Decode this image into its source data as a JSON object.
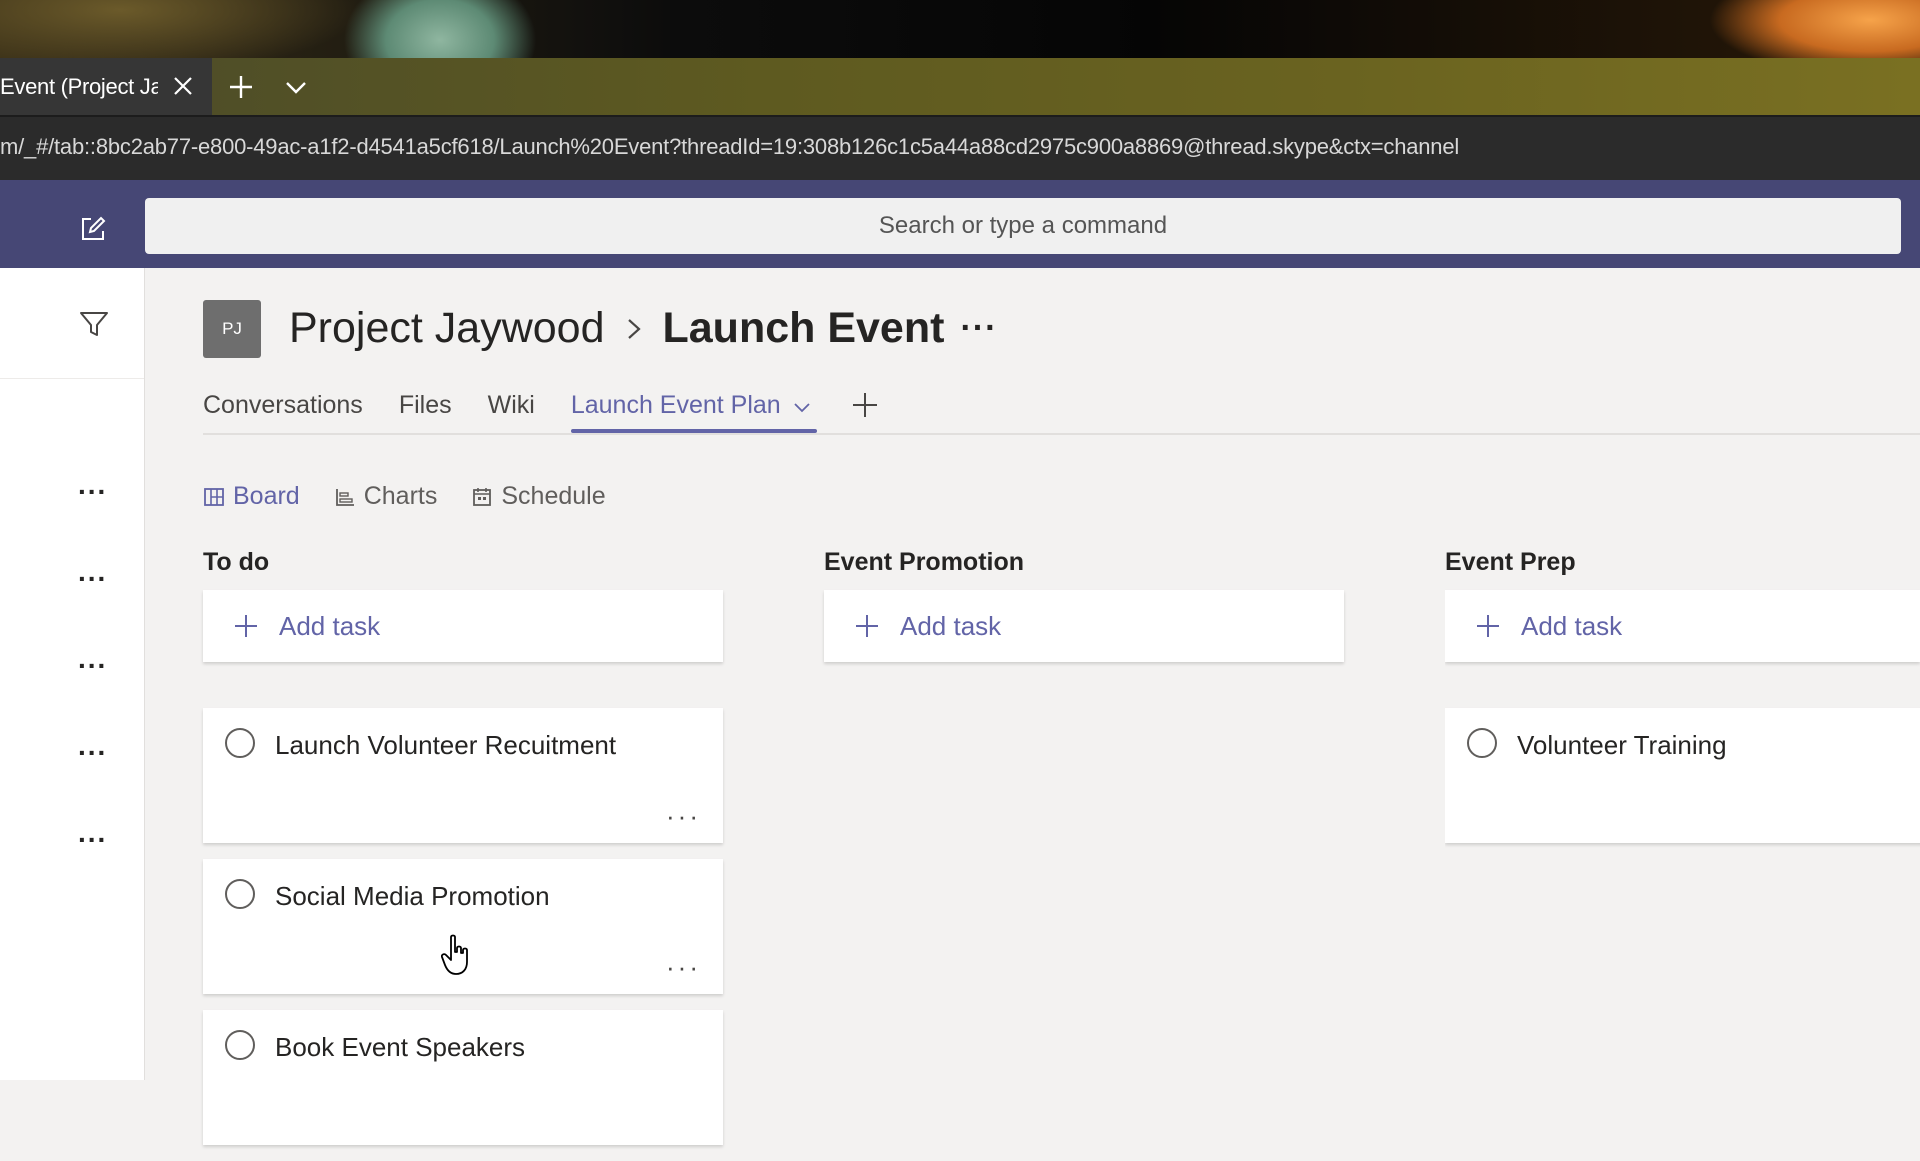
{
  "browser": {
    "tab_title": "Event (Project Ja",
    "url": "m/_#/tab::8bc2ab77-e800-49ac-a1f2-d4541a5cf618/Launch%20Event?threadId=19:308b126c1c5a44a88cd2975c900a8869@thread.skype&ctx=channel"
  },
  "header": {
    "search_placeholder": "Search or type a command"
  },
  "team": {
    "avatar_initials": "PJ",
    "team_name": "Project Jaywood",
    "channel_name": "Launch Event",
    "more": "···"
  },
  "channel_tabs": [
    {
      "label": "Conversations"
    },
    {
      "label": "Files"
    },
    {
      "label": "Wiki"
    },
    {
      "label": "Launch Event Plan",
      "active": true
    }
  ],
  "views": [
    {
      "label": "Board",
      "icon": "board-icon",
      "active": true
    },
    {
      "label": "Charts",
      "icon": "charts-icon"
    },
    {
      "label": "Schedule",
      "icon": "schedule-icon"
    }
  ],
  "rail": {
    "more_label": "..."
  },
  "buckets": [
    {
      "title": "To do",
      "add_label": "Add task",
      "tasks": [
        {
          "title": "Launch Volunteer Recuitment"
        },
        {
          "title": "Social Media Promotion"
        },
        {
          "title": "Book Event Speakers"
        }
      ]
    },
    {
      "title": "Event Promotion",
      "add_label": "Add task",
      "tasks": []
    },
    {
      "title": "Event Prep",
      "add_label": "Add task",
      "tasks": [
        {
          "title": "Volunteer Training"
        }
      ]
    }
  ],
  "task_more": "···",
  "colors": {
    "accent": "#6264a7",
    "header": "#464775",
    "canvas": "#f3f2f1"
  }
}
